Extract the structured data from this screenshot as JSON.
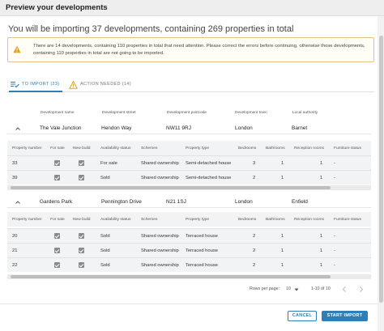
{
  "dialog": {
    "title": "Preview your developments"
  },
  "summary": {
    "headline": "You will be importing 37 developments, containing 269 properties in total"
  },
  "warning": {
    "text": "There are 14 developments, containing 110 properties in total that need attention. Please correct the errors before continuing, otherwise those developments, containing 110 properties in total are not going to be imported.",
    "color": "#e0a11b"
  },
  "tabs": [
    {
      "label": "TO IMPORT (23)",
      "icon": "playlist-check-icon",
      "active": true
    },
    {
      "label": "ACTION NEEDED (14)",
      "icon": "warning-icon",
      "active": false
    }
  ],
  "dev_columns": [
    "Development name",
    "Development street",
    "Development postcode",
    "Development town",
    "Local authority"
  ],
  "prop_columns": [
    "Property number",
    "For sale",
    "New build",
    "Availability status",
    "Schemes",
    "Property type",
    "Bedrooms",
    "Bathrooms",
    "Reception rooms",
    "Furniture status"
  ],
  "developments": [
    {
      "name": "The Vale Junction",
      "street": "Hendon Way",
      "postcode": "NW11 9RJ",
      "town": "London",
      "authority": "Barnet",
      "properties": [
        {
          "number": "33",
          "for_sale": true,
          "new_build": true,
          "status": "For sale",
          "scheme": "Shared ownership",
          "type": "Semi-detached house",
          "bedrooms": "3",
          "bathrooms": "1",
          "reception": "1",
          "furniture": "-"
        },
        {
          "number": "39",
          "for_sale": true,
          "new_build": true,
          "status": "Sold",
          "scheme": "Shared ownership",
          "type": "Semi-detached house",
          "bedrooms": "2",
          "bathrooms": "1",
          "reception": "1",
          "furniture": "-"
        }
      ]
    },
    {
      "name": "Gardens Park",
      "street": "Pennington Drive",
      "postcode": "N21 1SJ",
      "town": "London",
      "authority": "Enfield",
      "properties": [
        {
          "number": "20",
          "for_sale": true,
          "new_build": true,
          "status": "Sold",
          "scheme": "Shared ownership",
          "type": "Terraced house",
          "bedrooms": "2",
          "bathrooms": "1",
          "reception": "1",
          "furniture": "-"
        },
        {
          "number": "21",
          "for_sale": true,
          "new_build": true,
          "status": "Sold",
          "scheme": "Shared ownership",
          "type": "Terraced house",
          "bedrooms": "2",
          "bathrooms": "1",
          "reception": "1",
          "furniture": "-"
        },
        {
          "number": "22",
          "for_sale": true,
          "new_build": true,
          "status": "Sold",
          "scheme": "Shared ownership",
          "type": "Terraced house",
          "bedrooms": "2",
          "bathrooms": "1",
          "reception": "1",
          "furniture": "-"
        }
      ]
    }
  ],
  "pagination": {
    "rows_per_page_label": "Rows per page:",
    "rows_per_page": "10",
    "range": "1-10 of 10"
  },
  "buttons": {
    "cancel": "CANCEL",
    "start": "START IMPORT"
  },
  "colors": {
    "accent": "#2e7fb8",
    "warning": "#e0a11b"
  }
}
